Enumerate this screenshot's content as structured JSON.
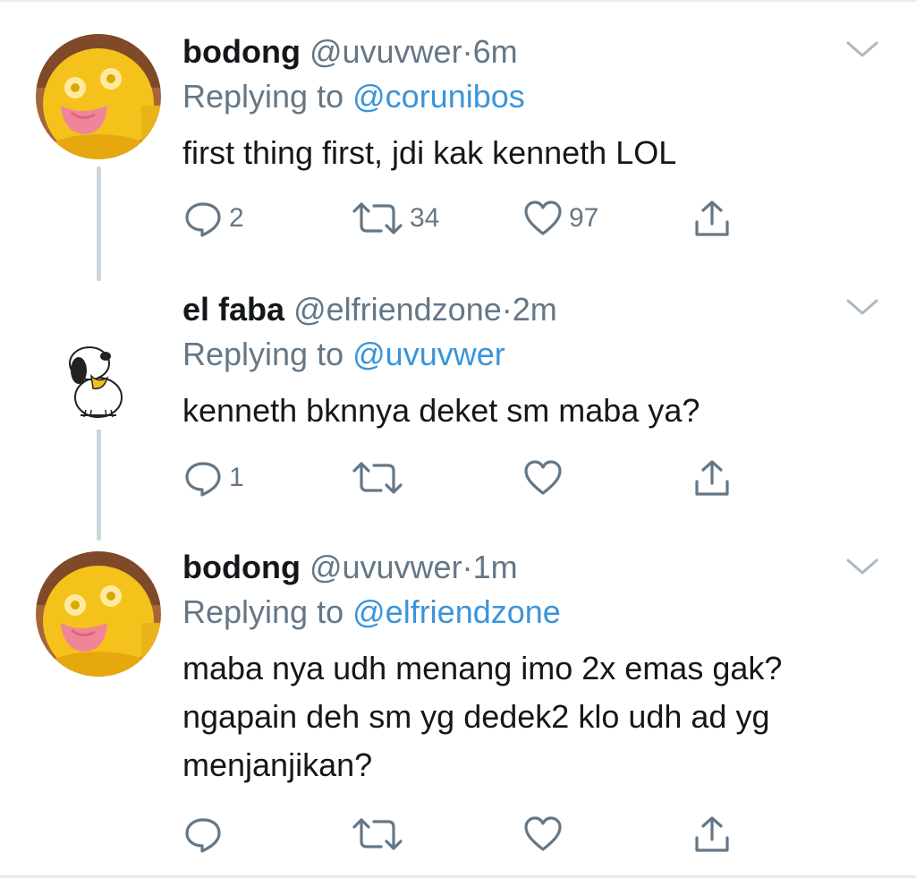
{
  "tweets": [
    {
      "name": "bodong",
      "handle": "@uvuvwer",
      "separator": "·",
      "time": "6m",
      "replying_prefix": "Replying to",
      "replying_to": "@corunibos",
      "text_lines": [
        "first thing first, jdi kak kenneth LOL"
      ],
      "replies": "2",
      "retweets": "34",
      "likes": "97",
      "avatar": "yellow-character"
    },
    {
      "name": "el faba",
      "handle": "@elfriendzone",
      "separator": "·",
      "time": "2m",
      "replying_prefix": "Replying to",
      "replying_to": "@uvuvwer",
      "text_lines": [
        "kenneth bknnya deket sm maba ya?"
      ],
      "replies": "1",
      "retweets": "",
      "likes": "",
      "avatar": "snoopy"
    },
    {
      "name": "bodong",
      "handle": "@uvuvwer",
      "separator": "·",
      "time": "1m",
      "replying_prefix": "Replying to",
      "replying_to": "@elfriendzone",
      "text_lines": [
        "maba nya udh menang imo 2x emas gak?",
        "ngapain deh sm yg dedek2 klo udh ad yg",
        "menjanjikan?"
      ],
      "replies": "",
      "retweets": "",
      "likes": "",
      "avatar": "yellow-character"
    }
  ],
  "colors": {
    "link": "#3b94d9",
    "muted": "#657786",
    "text": "#14171a",
    "thread": "#ccd6dd"
  },
  "icons": [
    "reply-icon",
    "retweet-icon",
    "like-icon",
    "share-icon",
    "chevron-down-icon"
  ]
}
